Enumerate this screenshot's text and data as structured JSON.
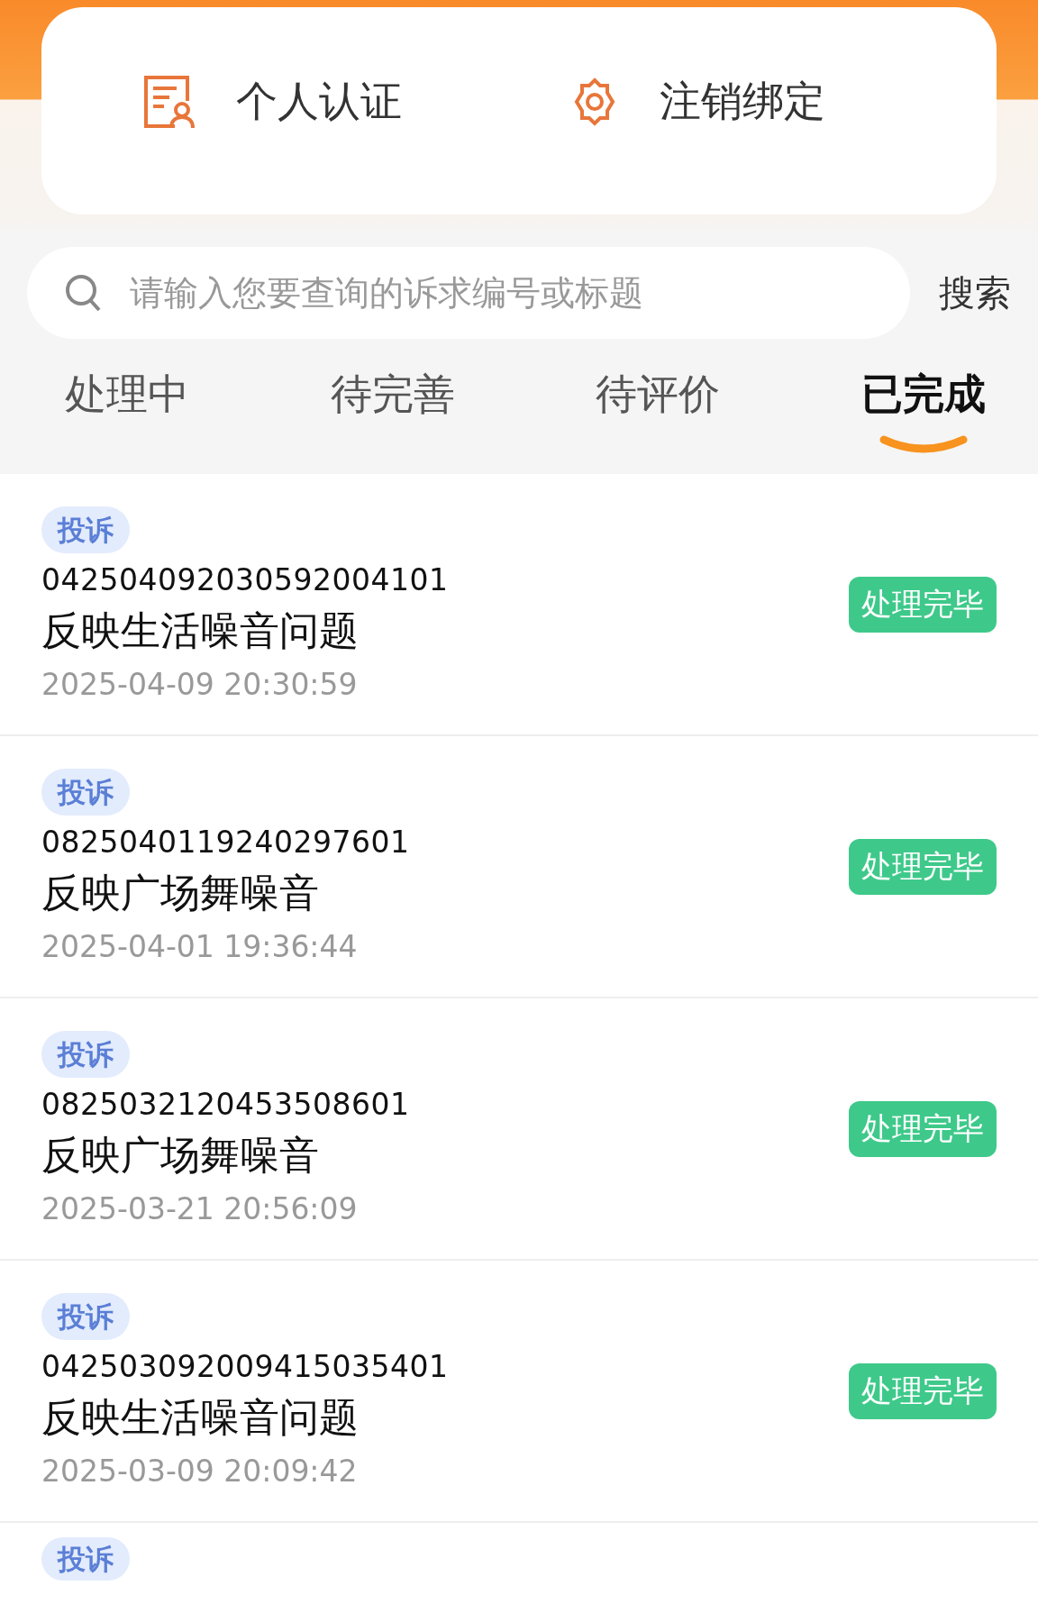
{
  "quick_actions": [
    {
      "kind": "certificate",
      "label": "个人认证"
    },
    {
      "kind": "gear",
      "label": "注销绑定"
    }
  ],
  "search": {
    "placeholder": "请输入您要查询的诉求编号或标题",
    "button": "搜索"
  },
  "tabs": [
    {
      "label": "处理中",
      "selected": false
    },
    {
      "label": "待完善",
      "selected": false
    },
    {
      "label": "待评价",
      "selected": false
    },
    {
      "label": "已完成",
      "selected": true
    }
  ],
  "records": [
    {
      "tag": "投诉",
      "number": "042504092030592004101",
      "title": "反映生活噪音问题",
      "time": "2025-04-09 20:30:59",
      "status": "处理完毕"
    },
    {
      "tag": "投诉",
      "number": "0825040119240297601",
      "title": "反映广场舞噪音",
      "time": "2025-04-01 19:36:44",
      "status": "处理完毕"
    },
    {
      "tag": "投诉",
      "number": "0825032120453508601",
      "title": "反映广场舞噪音",
      "time": "2025-03-21 20:56:09",
      "status": "处理完毕"
    },
    {
      "tag": "投诉",
      "number": "042503092009415035401",
      "title": "反映生活噪音问题",
      "time": "2025-03-09 20:09:42",
      "status": "处理完毕"
    },
    {
      "tag": "投诉"
    }
  ]
}
